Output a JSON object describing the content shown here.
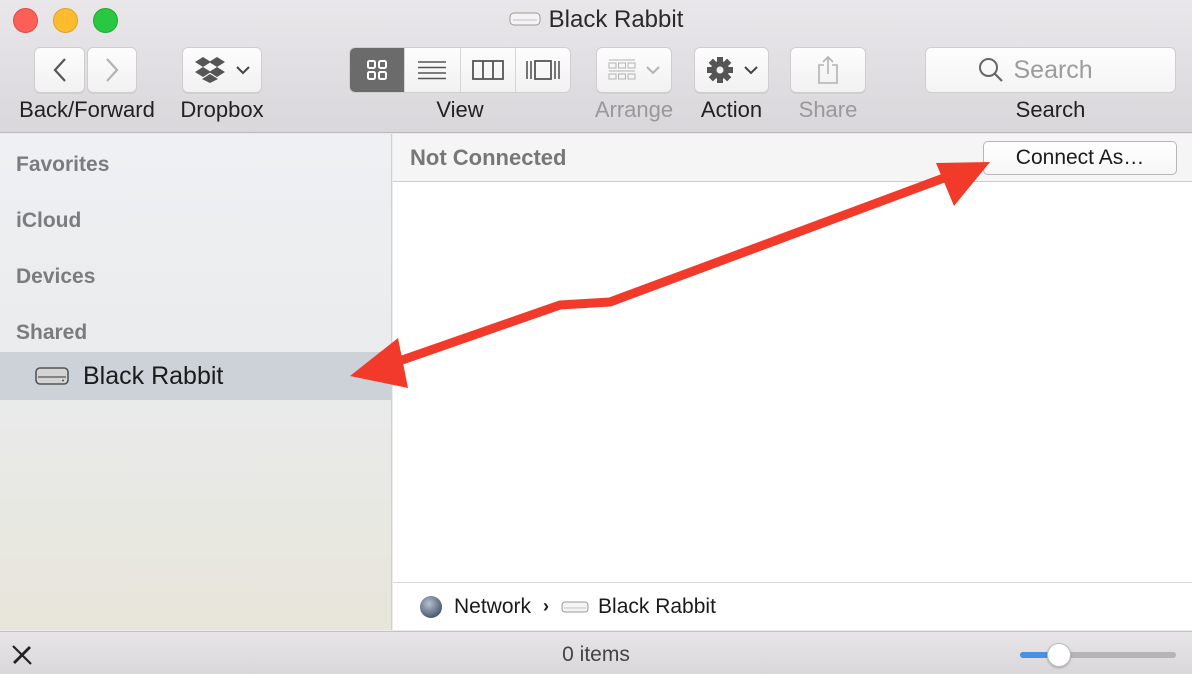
{
  "window": {
    "title": "Black Rabbit"
  },
  "toolbar": {
    "back_forward_label": "Back/Forward",
    "dropbox_label": "Dropbox",
    "view_label": "View",
    "view_modes": [
      "icon",
      "list",
      "column",
      "cover-flow"
    ],
    "active_view": "icon",
    "arrange_label": "Arrange",
    "action_label": "Action",
    "share_label": "Share",
    "search_label": "Search",
    "search_placeholder": "Search"
  },
  "sidebar": {
    "sections": [
      {
        "heading": "Favorites"
      },
      {
        "heading": "iCloud"
      },
      {
        "heading": "Devices"
      },
      {
        "heading": "Shared",
        "items": [
          {
            "label": "Black Rabbit",
            "icon": "network-drive-icon",
            "selected": true
          }
        ]
      }
    ]
  },
  "main": {
    "connection_status": "Not Connected",
    "connect_button": "Connect As…"
  },
  "path_bar": {
    "segments": [
      {
        "label": "Network",
        "icon": "globe-icon"
      },
      {
        "label": "Black Rabbit",
        "icon": "network-drive-icon"
      }
    ]
  },
  "status_bar": {
    "item_count": "0 items",
    "icon_size_slider": 0.25
  },
  "annotation": {
    "color": "#f23a2a",
    "description": "double-headed arrow linking sidebar item to Connect As button"
  }
}
